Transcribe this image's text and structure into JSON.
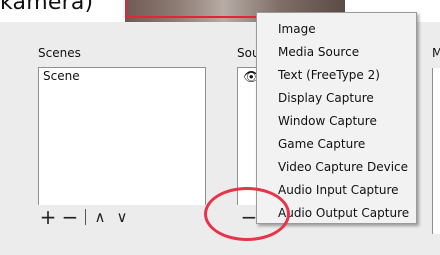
{
  "top": {
    "caption": "kamera)"
  },
  "scenes": {
    "title": "Scenes",
    "items": [
      "Scene"
    ],
    "toolbar": {
      "add": "+",
      "remove": "−",
      "up": "∧",
      "down": "∨"
    }
  },
  "sources": {
    "title": "Sou",
    "toolbar": {
      "remove": "−"
    }
  },
  "mixer": {
    "title": "M"
  },
  "context_menu": {
    "items": [
      "Image",
      "Media Source",
      "Text (FreeType 2)",
      "Display Capture",
      "Window Capture",
      "Game Capture",
      "Video Capture Device",
      "Audio Input Capture",
      "Audio Output Capture"
    ]
  },
  "colors": {
    "annotation": "#e8344a",
    "preview_border": "#e0263a",
    "background": "#ececec"
  }
}
